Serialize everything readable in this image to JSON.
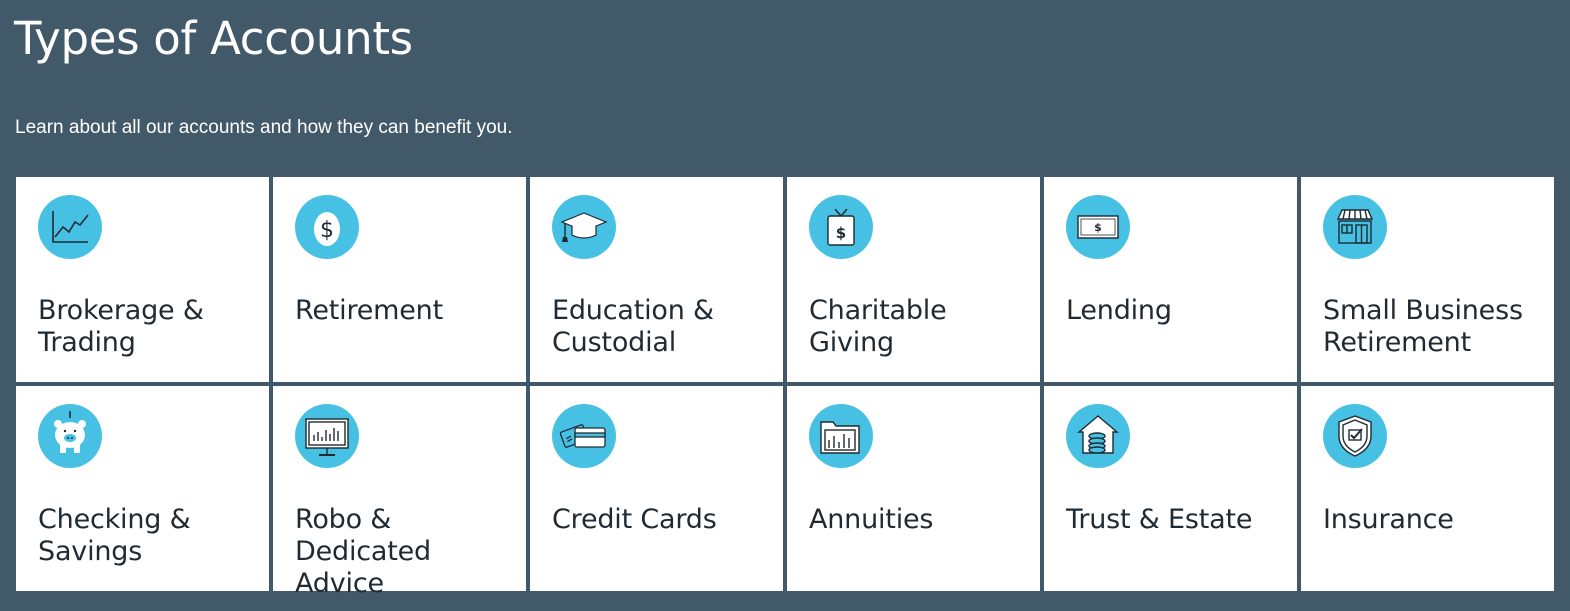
{
  "header": {
    "title": "Types of Accounts",
    "subtitle": "Learn about all our accounts and how they can benefit you."
  },
  "accent_color": "#47c1e3",
  "background_color": "#42596a",
  "cards": [
    {
      "label": "Brokerage & Trading",
      "icon": "line-chart-icon"
    },
    {
      "label": "Retirement",
      "icon": "dollar-egg-icon"
    },
    {
      "label": "Education & Custodial",
      "icon": "graduation-cap-icon"
    },
    {
      "label": "Charitable Giving",
      "icon": "gift-tag-dollar-icon"
    },
    {
      "label": "Lending",
      "icon": "banknote-icon"
    },
    {
      "label": "Small Business Retirement",
      "icon": "storefront-icon"
    },
    {
      "label": "Checking & Savings",
      "icon": "piggy-bank-icon"
    },
    {
      "label": "Robo & Dedicated Advice",
      "icon": "monitor-chart-icon"
    },
    {
      "label": "Credit Cards",
      "icon": "credit-cards-icon"
    },
    {
      "label": "Annuities",
      "icon": "folder-chart-icon"
    },
    {
      "label": "Trust & Estate",
      "icon": "house-coins-icon"
    },
    {
      "label": "Insurance",
      "icon": "shield-check-icon"
    }
  ]
}
